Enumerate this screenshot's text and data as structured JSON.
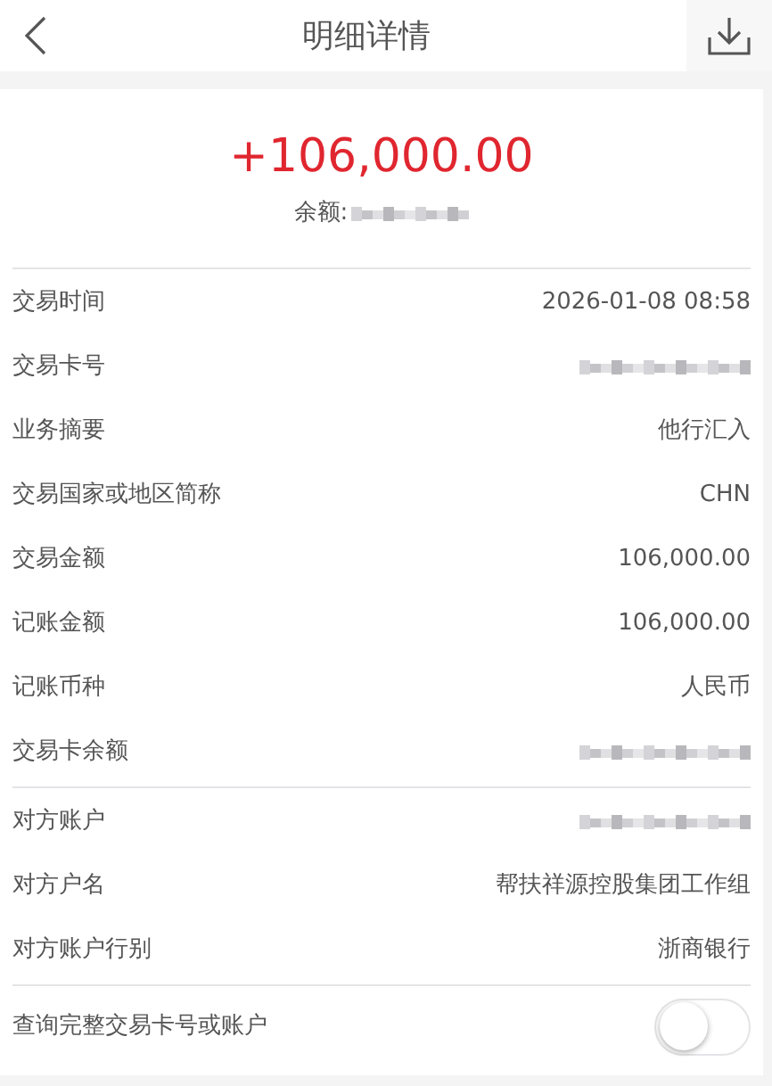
{
  "header": {
    "title": "明细详情"
  },
  "summary": {
    "amount": "+106,000.00",
    "balance_label": "余额:",
    "balance_masked": true
  },
  "sections": [
    {
      "rows": [
        {
          "label": "交易时间",
          "kind": "text",
          "value": "2026-01-08 08:58"
        },
        {
          "label": "交易卡号",
          "kind": "masked"
        },
        {
          "label": "业务摘要",
          "kind": "text",
          "value": "他行汇入"
        },
        {
          "label": "交易国家或地区简称",
          "kind": "text",
          "value": "CHN"
        },
        {
          "label": "交易金额",
          "kind": "text",
          "value": "106,000.00"
        },
        {
          "label": "记账金额",
          "kind": "text",
          "value": "106,000.00"
        },
        {
          "label": "记账币种",
          "kind": "text",
          "value": "人民币"
        },
        {
          "label": "交易卡余额",
          "kind": "masked"
        }
      ]
    },
    {
      "rows": [
        {
          "label": "对方账户",
          "kind": "masked"
        },
        {
          "label": "对方户名",
          "kind": "text",
          "value": "帮扶祥源控股集团工作组"
        },
        {
          "label": "对方账户行别",
          "kind": "text",
          "value": "浙商银行"
        }
      ]
    }
  ],
  "toggle": {
    "label": "查询完整交易卡号或账户",
    "on": false
  }
}
